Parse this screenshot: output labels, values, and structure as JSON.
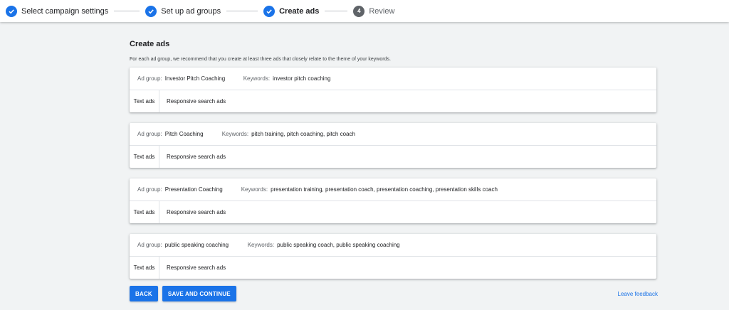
{
  "stepper": {
    "steps": [
      {
        "label": "Select campaign settings",
        "status": "done"
      },
      {
        "label": "Set up ad groups",
        "status": "done"
      },
      {
        "label": "Create ads",
        "status": "active"
      },
      {
        "label": "Review",
        "status": "pending",
        "number": "4"
      }
    ]
  },
  "main": {
    "title": "Create ads",
    "subtitle": "For each ad group, we recommend that you create at least three ads that closely relate to the theme of your keywords.",
    "ad_group_label": "Ad group:",
    "keywords_label": "Keywords:",
    "tab_text_ads": "Text ads",
    "tab_responsive": "Responsive search ads",
    "ad_groups": [
      {
        "name": "Investor Pitch Coaching",
        "keywords": "investor pitch coaching"
      },
      {
        "name": "Pitch Coaching",
        "keywords": "pitch training, pitch coaching, pitch coach"
      },
      {
        "name": "Presentation Coaching",
        "keywords": "presentation training, presentation coach, presentation coaching, presentation skills coach"
      },
      {
        "name": "public speaking coaching",
        "keywords": "public speaking coach, public speaking coaching"
      }
    ]
  },
  "footer": {
    "back_label": "BACK",
    "continue_label": "SAVE AND CONTINUE",
    "feedback_label": "Leave feedback"
  },
  "colors": {
    "accent": "#1a73e8",
    "background": "#f1f3f4"
  },
  "icons": {
    "done": "check-icon"
  }
}
